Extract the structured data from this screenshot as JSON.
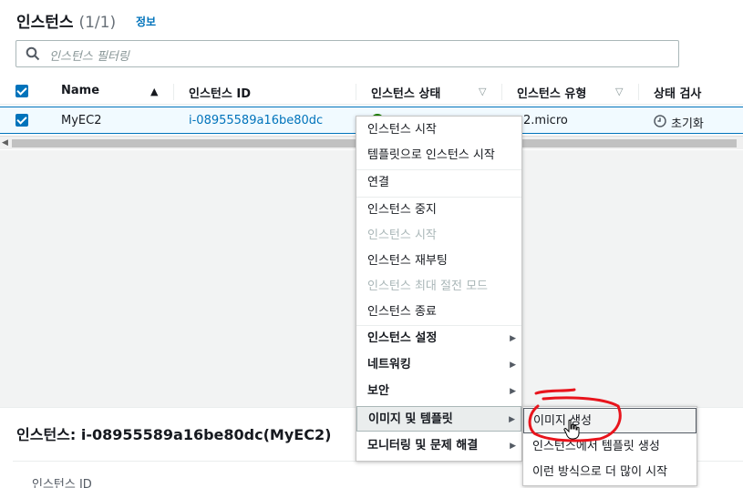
{
  "panel": {
    "title": "인스턴스",
    "count": "(1/1)",
    "info_link": "정보",
    "search_placeholder": "인스턴스 필터링"
  },
  "table": {
    "headers": {
      "name": "Name",
      "instance_id": "인스턴스 ID",
      "state": "인스턴스 상태",
      "type": "인스턴스 유형",
      "status_check": "상태 검사"
    },
    "row": {
      "name": "MyEC2",
      "instance_id": "i-08955589a16be80dc",
      "type": "2.micro",
      "status_check": "초기화"
    }
  },
  "details": {
    "title": "인스턴스: i-08955589a16be80dc(MyEC2)",
    "field_label": "인스턴스 ID"
  },
  "context_menu": {
    "items": [
      {
        "label": "인스턴스 시작"
      },
      {
        "label": "템플릿으로 인스턴스 시작"
      },
      {
        "label": "연결"
      },
      {
        "label": "인스턴스 중지"
      },
      {
        "label": "인스턴스 시작"
      },
      {
        "label": "인스턴스 재부팅"
      },
      {
        "label": "인스턴스 최대 절전 모드"
      },
      {
        "label": "인스턴스 종료"
      },
      {
        "label": "인스턴스 설정"
      },
      {
        "label": "네트워킹"
      },
      {
        "label": "보안"
      },
      {
        "label": "이미지 및 템플릿"
      },
      {
        "label": "모니터링 및 문제 해결"
      }
    ]
  },
  "submenu": {
    "items": [
      {
        "label": "이미지 생성"
      },
      {
        "label": "인스턴스에서 템플릿 생성"
      },
      {
        "label": "이런 방식으로 더 많이 시작"
      }
    ]
  },
  "colors": {
    "accent": "#0073bb",
    "annotation": "#e8141c",
    "running": "#1d8102"
  }
}
